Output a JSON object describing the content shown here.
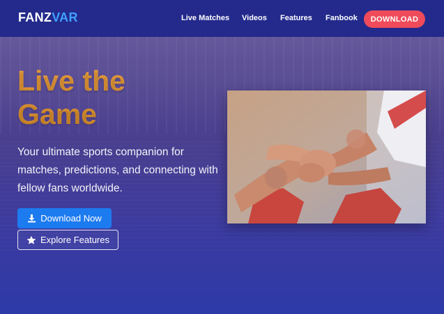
{
  "brand": {
    "logo_main": "FANZ",
    "logo_accent": "VAR"
  },
  "nav": {
    "items": [
      {
        "label": "Live Matches"
      },
      {
        "label": "Videos"
      },
      {
        "label": "Features"
      },
      {
        "label": "Fanbook"
      }
    ],
    "download_label": "DOWNLOAD"
  },
  "hero": {
    "title_line1": "Live the",
    "title_line2": "Game",
    "subtitle": "Your ultimate sports companion for matches, predictions, and connecting with fellow fans worldwide.",
    "primary_button": "Download Now",
    "secondary_button": "Explore Features",
    "image_icon": "team-hands-photo"
  },
  "colors": {
    "nav_bg": "#232a8c",
    "accent_blue": "#3fa0ff",
    "download_red": "#ef4b5a",
    "title_orange": "#e79a3c",
    "primary_btn": "#1d7bf0"
  }
}
